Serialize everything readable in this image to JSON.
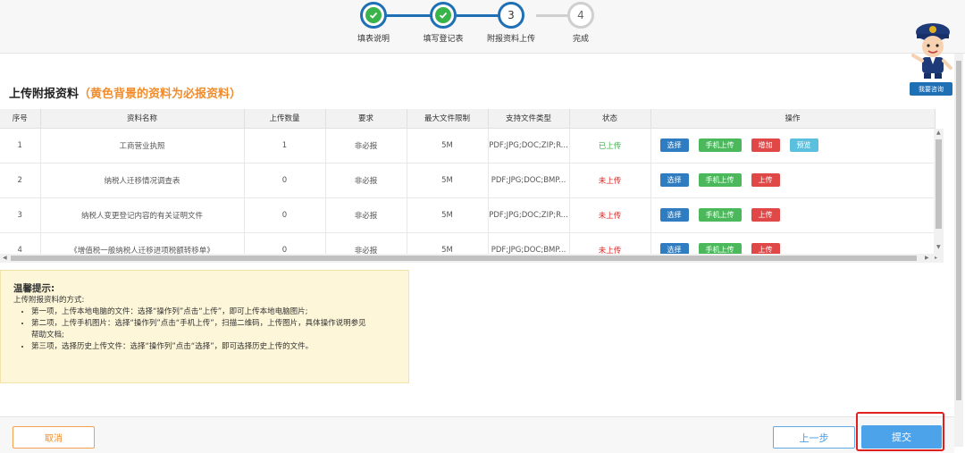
{
  "steps": [
    {
      "label": "填表说明",
      "state": "done"
    },
    {
      "label": "填写登记表",
      "state": "done"
    },
    {
      "label": "附报资料上传",
      "state": "current",
      "number": "3"
    },
    {
      "label": "完成",
      "state": "todo",
      "number": "4"
    }
  ],
  "assistant": {
    "button_label": "我要咨询"
  },
  "section": {
    "title": "上传附报资料",
    "hint": "（黄色背景的资料为必报资料）"
  },
  "table": {
    "headers": [
      "序号",
      "资料名称",
      "上传数量",
      "要求",
      "最大文件限制",
      "支持文件类型",
      "状态",
      "操作"
    ],
    "rows": [
      {
        "index": "1",
        "name": "工商营业执照",
        "count": "1",
        "requirement": "非必报",
        "max_size": "5M",
        "types": "PDF;JPG;DOC;ZIP;R...",
        "status": "已上传",
        "ops": [
          "选择",
          "手机上传",
          "增加",
          "预览"
        ]
      },
      {
        "index": "2",
        "name": "纳税人迁移情况调查表",
        "count": "0",
        "requirement": "非必报",
        "max_size": "5M",
        "types": "PDF;JPG;DOC;BMP...",
        "status": "未上传",
        "ops": [
          "选择",
          "手机上传",
          "上传"
        ]
      },
      {
        "index": "3",
        "name": "纳税人变更登记内容的有关证明文件",
        "count": "0",
        "requirement": "非必报",
        "max_size": "5M",
        "types": "PDF;JPG;DOC;ZIP;R...",
        "status": "未上传",
        "ops": [
          "选择",
          "手机上传",
          "上传"
        ]
      },
      {
        "index": "4",
        "name": "《增值税一般纳税人迁移进项税额转移单》",
        "count": "0",
        "requirement": "非必报",
        "max_size": "5M",
        "types": "PDF;JPG;DOC;BMP...",
        "status": "未上传",
        "ops": [
          "选择",
          "手机上传",
          "上传"
        ]
      }
    ]
  },
  "tips": {
    "title": "温馨提示:",
    "intro": "上传附报资料的方式:",
    "items": [
      "第一项，上传本地电脑的文件：选择“操作列”点击“上传”，即可上传本地电脑图片;",
      "第二项，上传手机图片：选择“操作列”点击“手机上传”，扫描二维码，上传图片，具体操作说明参见帮助文档;",
      "第三项，选择历史上传文件：选择“操作列”点击“选择”，即可选择历史上传的文件。"
    ]
  },
  "footer": {
    "cancel": "取消",
    "prev": "上一步",
    "submit": "提交"
  },
  "colors": {
    "primary": "#1f6fb5",
    "success": "#3ab34a",
    "danger": "#e02020",
    "warning": "#f08c2c",
    "tips_bg": "#fdf6d8"
  }
}
